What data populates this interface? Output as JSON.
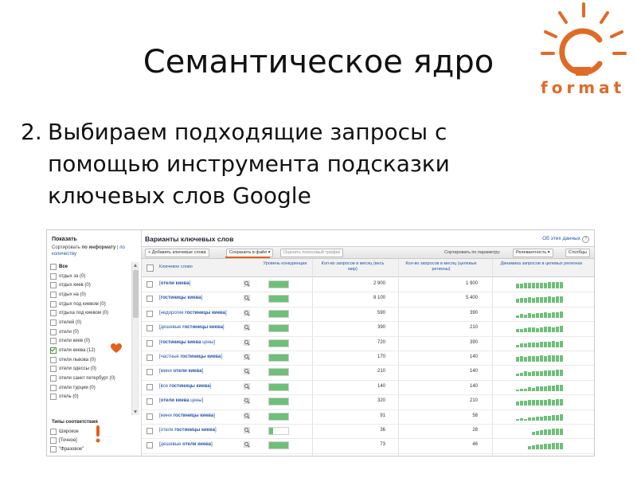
{
  "slide": {
    "title": "Семантическое ядро",
    "point_number": "2.",
    "point_lines": [
      "Выбираем подходящие запросы с",
      "помощью инструмента подсказки",
      "ключевых слов Google"
    ]
  },
  "logo": {
    "text": "format",
    "color": "#e06a28",
    "icon": "sun-bulb-icon"
  },
  "filter_panel": {
    "title": "Показать",
    "sort_prefix": "Сортировать ",
    "sort_relevance": "по информату",
    "sort_sep": " | ",
    "sort_count": "по количеству",
    "items": [
      {
        "label": "Все",
        "checked": false,
        "bold": true
      },
      {
        "label": "отдых за (0)",
        "checked": false
      },
      {
        "label": "отдых киев (0)",
        "checked": false
      },
      {
        "label": "отдых на (0)",
        "checked": false
      },
      {
        "label": "отдых под киевом (0)",
        "checked": false
      },
      {
        "label": "отдыха под киевом (0)",
        "checked": false
      },
      {
        "label": "отелей (0)",
        "checked": false
      },
      {
        "label": "отели (0)",
        "checked": false
      },
      {
        "label": "отели киев (0)",
        "checked": false
      },
      {
        "label": "отели киева (12)",
        "checked": true
      },
      {
        "label": "отели львова (0)",
        "checked": false
      },
      {
        "label": "отели одессы (0)",
        "checked": false
      },
      {
        "label": "отели санкт петербург (0)",
        "checked": false
      },
      {
        "label": "отели турции (0)",
        "checked": false
      },
      {
        "label": "отель (0)",
        "checked": false
      }
    ],
    "match_types_title": "Типы соответствия",
    "match_types": [
      {
        "label": "Широкое",
        "checked": false
      },
      {
        "label": "[Точное]",
        "checked": false
      },
      {
        "label": "\"Фразовое\"",
        "checked": false
      }
    ]
  },
  "results": {
    "title": "Варианты ключевых слов",
    "about_link": "Об этих данных",
    "toolbar": {
      "add_label": "+ Добавить ключевые слова",
      "save_label": "Сохранить в файл ▾",
      "estimate_label": "Оценить поисковый трафик",
      "sort_label": "Сортировать по параметру:",
      "sort_value": "Релевантность ▾",
      "columns_label": "Столбцы"
    },
    "headers": {
      "keyword": "Ключевое слово",
      "competition": "Уровень конкуренции",
      "global": "Кол-во запросов в месяц (весь мир)",
      "local": "Кол-во запросов в месяц (целевые регионы)",
      "trend": "Динамика запросов в целевых регионах"
    },
    "rows": [
      {
        "prefix": "[",
        "bold": "отели киева",
        "suffix": "]",
        "global": "2 900",
        "local": "1 900",
        "competition": 1.0
      },
      {
        "prefix": "[",
        "bold": "гостиницы киева",
        "suffix": "]",
        "global": "8 100",
        "local": "5 400",
        "competition": 1.0
      },
      {
        "prefix": "[недорогие ",
        "bold": "гостиницы киева",
        "suffix": "]",
        "global": "590",
        "local": "390",
        "competition": 1.0
      },
      {
        "prefix": "[дешевые ",
        "bold": "гостиницы киева",
        "suffix": "]",
        "global": "390",
        "local": "210",
        "competition": 1.0
      },
      {
        "prefix": "[",
        "bold": "гостиницы киева",
        "suffix": " цены]",
        "global": "720",
        "local": "390",
        "competition": 1.0
      },
      {
        "prefix": "[частные ",
        "bold": "гостиницы киева",
        "suffix": "]",
        "global": "170",
        "local": "140",
        "competition": 1.0
      },
      {
        "prefix": "[мини ",
        "bold": "отели киева",
        "suffix": "]",
        "global": "210",
        "local": "140",
        "competition": 1.0
      },
      {
        "prefix": "[все ",
        "bold": "гостиницы киева",
        "suffix": "]",
        "global": "140",
        "local": "140",
        "competition": 1.0
      },
      {
        "prefix": "[",
        "bold": "отели киева",
        "suffix": " цены]",
        "global": "320",
        "local": "210",
        "competition": 1.0
      },
      {
        "prefix": "[мини ",
        "bold": "гостиницы киева",
        "suffix": "]",
        "global": "91",
        "local": "58",
        "competition": 1.0
      },
      {
        "prefix": "[отели ",
        "bold": "гостиницы киева",
        "suffix": "]",
        "global": "36",
        "local": "28",
        "competition": 0.2
      },
      {
        "prefix": "[дешевые ",
        "bold": "отели киева",
        "suffix": "]",
        "global": "73",
        "local": "46",
        "competition": 1.0
      }
    ],
    "trend_color": "#6fbf7a",
    "competition_color": "#6fbf7a"
  }
}
